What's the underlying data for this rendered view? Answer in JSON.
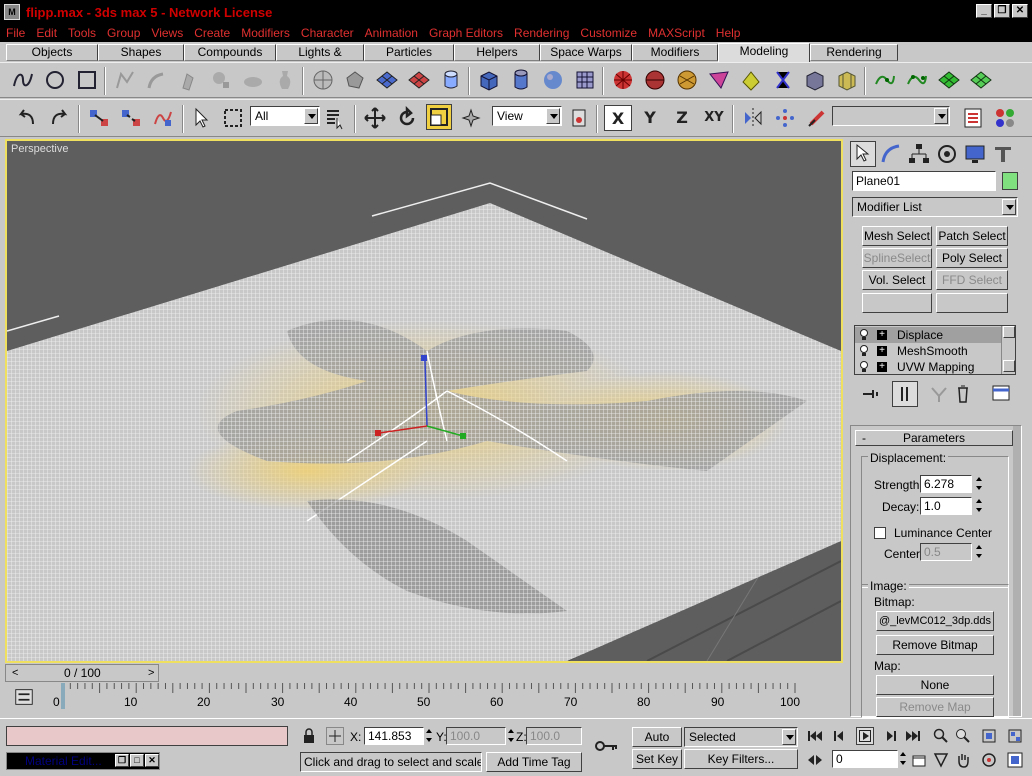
{
  "window": {
    "title": "flipp.max - 3ds max 5 - Network License",
    "app_icon": "3ds-max-icon",
    "controls": [
      "_",
      "❐",
      "✕"
    ]
  },
  "menubar": {
    "items": [
      "File",
      "Edit",
      "Tools",
      "Group",
      "Views",
      "Create",
      "Modifiers",
      "Character",
      "Animation",
      "Graph Editors",
      "Rendering",
      "Customize",
      "MAXScript",
      "Help"
    ]
  },
  "tabs": {
    "items": [
      "Objects",
      "Shapes",
      "Compounds",
      "Lights & Cameras",
      "Particles",
      "Helpers",
      "Space Warps",
      "Modifiers",
      "Modeling",
      "Rendering"
    ],
    "active": "Modeling"
  },
  "main_toolbar": {
    "selection_filter": "All",
    "reference_coord": "View",
    "axis_buttons": [
      "X",
      "Y",
      "Z",
      "XY"
    ],
    "named_selection": ""
  },
  "viewport": {
    "label": "Perspective",
    "border_color": "#f0e060"
  },
  "command_panel": {
    "object_name": "Plane01",
    "object_color": "#80e080",
    "modifier_list": "Modifier List",
    "modifier_buttons": [
      {
        "label": "Mesh Select",
        "enabled": true
      },
      {
        "label": "Patch Select",
        "enabled": true
      },
      {
        "label": "SplineSelect",
        "enabled": false
      },
      {
        "label": "Poly Select",
        "enabled": true
      },
      {
        "label": "Vol. Select",
        "enabled": true
      },
      {
        "label": "FFD Select",
        "enabled": false
      },
      {
        "label": "",
        "enabled": true
      },
      {
        "label": "",
        "enabled": true
      }
    ],
    "stack": [
      "Displace",
      "MeshSmooth",
      "UVW Mapping"
    ],
    "stack_selected": "Displace",
    "parameters": {
      "rollout_title": "Parameters",
      "rollout_toggle": "-",
      "displacement_label": "Displacement:",
      "strength_label": "Strength:",
      "strength": "6.278",
      "decay_label": "Decay:",
      "decay": "1.0",
      "luminance_center_label": "Luminance Center",
      "luminance_center": false,
      "center_label": "Center:",
      "center": "0.5",
      "image_label": "Image:",
      "bitmap_label": "Bitmap:",
      "bitmap": "@_levMC012_3dp.dds",
      "remove_bitmap": "Remove Bitmap",
      "map_label": "Map:",
      "map": "None",
      "remove_map": "Remove Map"
    }
  },
  "timeline": {
    "slider": "0 / 100",
    "ticks": [
      "0",
      "10",
      "20",
      "30",
      "40",
      "50",
      "60",
      "70",
      "80",
      "90",
      "100"
    ]
  },
  "statusbar": {
    "x_label": "X:",
    "x_value": "141.853",
    "y_label": "Y:",
    "y_value": "100.0",
    "z_label": "Z:",
    "z_value": "100.0",
    "prompt": "Click and drag to select and scale obj",
    "add_time_tag": "Add Time Tag",
    "auto_key": "Auto Key",
    "set_key": "Set Key",
    "key_mode": "Selected",
    "key_filters": "Key Filters...",
    "current_frame": "0",
    "minimized_window": "Material Edit..."
  }
}
